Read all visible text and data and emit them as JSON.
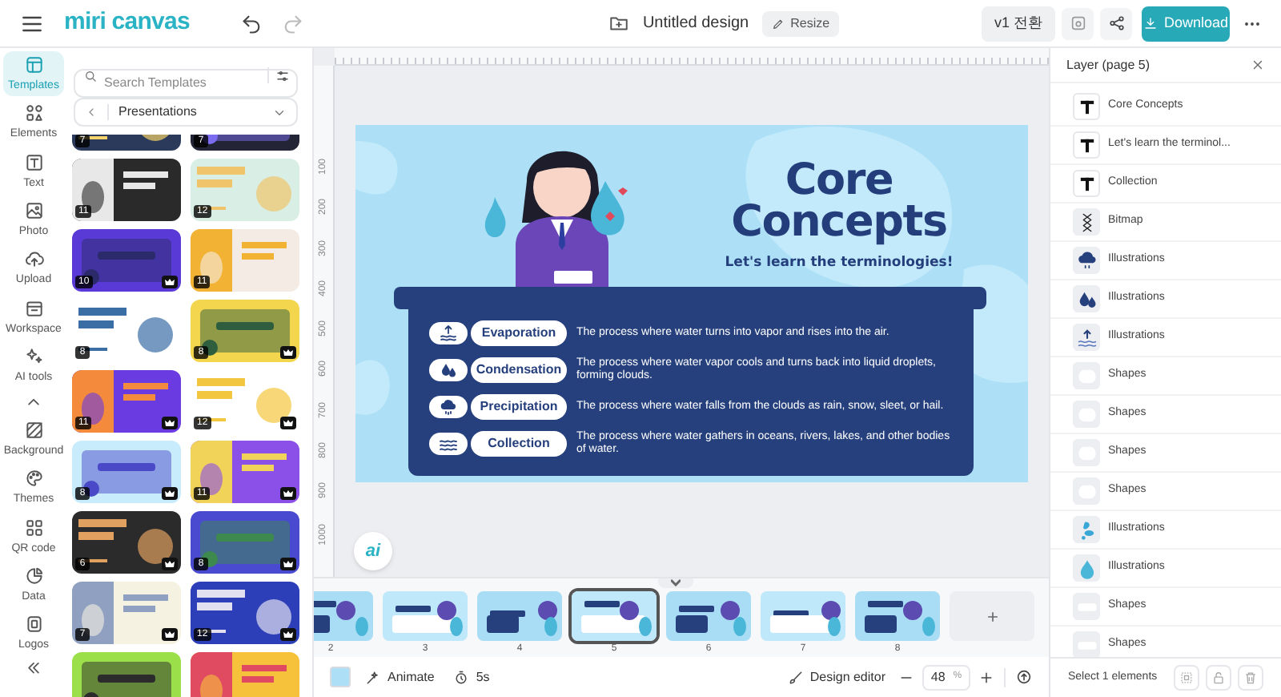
{
  "top_bar": {
    "logo": "miri canvas",
    "document_title": "Untitled design",
    "resize_button": "Resize",
    "version_button": "v1 전환",
    "download_button": "Download"
  },
  "rail": {
    "items": [
      {
        "kind": "tab",
        "label": "Templates",
        "selected": true
      },
      {
        "kind": "tab",
        "label": "Elements",
        "selected": false
      },
      {
        "kind": "tab",
        "label": "Text",
        "selected": false
      },
      {
        "kind": "tab",
        "label": "Photo",
        "selected": false
      },
      {
        "kind": "tab",
        "label": "Upload",
        "selected": false
      },
      {
        "kind": "tab",
        "label": "Workspace",
        "selected": false
      },
      {
        "kind": "tab",
        "label": "AI tools",
        "selected": false
      },
      {
        "kind": "toggle"
      },
      {
        "kind": "tab",
        "label": "Background",
        "selected": false
      },
      {
        "kind": "tab",
        "label": "Themes",
        "selected": false
      },
      {
        "kind": "tab",
        "label": "QR code",
        "selected": false
      },
      {
        "kind": "tab",
        "label": "Data",
        "selected": false
      },
      {
        "kind": "tab",
        "label": "Logos",
        "selected": false
      },
      {
        "kind": "toggle"
      }
    ]
  },
  "templates": {
    "search": {
      "placeholder": "Search Templates"
    },
    "category": "Presentations",
    "thumbnails": [
      {
        "pages": "7",
        "premium": false
      },
      {
        "pages": "7",
        "premium": false
      },
      {
        "pages": "11",
        "premium": false
      },
      {
        "pages": "12",
        "premium": false
      },
      {
        "pages": "10",
        "premium": true
      },
      {
        "pages": "11",
        "premium": false
      },
      {
        "pages": "8",
        "premium": false
      },
      {
        "pages": "8",
        "premium": true
      },
      {
        "pages": "11",
        "premium": true
      },
      {
        "pages": "12",
        "premium": true
      },
      {
        "pages": "8",
        "premium": true
      },
      {
        "pages": "11",
        "premium": true
      },
      {
        "pages": "6",
        "premium": true
      },
      {
        "pages": "8",
        "premium": true
      },
      {
        "pages": "7",
        "premium": true
      },
      {
        "pages": "12",
        "premium": true
      },
      {
        "premium": false
      },
      {
        "premium": false
      }
    ]
  },
  "ruler": {
    "left_labels": [
      "100",
      "200",
      "300",
      "400",
      "500",
      "600",
      "700",
      "800",
      "900",
      "1000"
    ]
  },
  "slide": {
    "title": "Core Concepts",
    "subtitle": "Let's learn the terminologies!",
    "terms": [
      {
        "kind": "evaporation",
        "name": "Evaporation",
        "description": "The process where water turns into vapor and rises into the air."
      },
      {
        "kind": "condensation",
        "name": "Condensation",
        "description": "The process where water vapor cools and turns back into liquid droplets, forming clouds."
      },
      {
        "kind": "precipitation",
        "name": "Precipitation",
        "description": "The process where water falls from the clouds as rain, snow, sleet, or hail."
      },
      {
        "kind": "collection",
        "name": "Collection",
        "description": "The process where water gathers in oceans, rivers, lakes, and other bodies of water."
      }
    ]
  },
  "ai_button": "ai",
  "filmstrip": {
    "pages": [
      {
        "number": "2",
        "selected": false
      },
      {
        "number": "3",
        "selected": false
      },
      {
        "number": "4",
        "selected": false
      },
      {
        "number": "5",
        "selected": true
      },
      {
        "number": "6",
        "selected": false
      },
      {
        "number": "7",
        "selected": false
      },
      {
        "number": "8",
        "selected": false
      }
    ]
  },
  "bottom_bar": {
    "animate_button": "Animate",
    "duration": "5s",
    "design_editor_button": "Design editor",
    "zoom_value": "48",
    "zoom_unit": "%"
  },
  "layers": {
    "title": "Layer (page 5)",
    "items": [
      {
        "kind": "text",
        "label": "Core Concepts"
      },
      {
        "kind": "text",
        "label": "Let's learn the terminol..."
      },
      {
        "kind": "text",
        "label": "Collection"
      },
      {
        "kind": "bitmap",
        "label": "Bitmap"
      },
      {
        "kind": "cloud",
        "label": "Illustrations"
      },
      {
        "kind": "drops",
        "label": "Illustrations"
      },
      {
        "kind": "evaporation",
        "label": "Illustrations"
      },
      {
        "kind": "shape",
        "label": "Shapes"
      },
      {
        "kind": "shape",
        "label": "Shapes"
      },
      {
        "kind": "shape",
        "label": "Shapes"
      },
      {
        "kind": "shape",
        "label": "Shapes"
      },
      {
        "kind": "splash",
        "label": "Illustrations"
      },
      {
        "kind": "drop",
        "label": "Illustrations"
      },
      {
        "kind": "bar",
        "label": "Shapes"
      },
      {
        "kind": "bar",
        "label": "Shapes"
      }
    ],
    "footer": "Select 1 elements"
  }
}
